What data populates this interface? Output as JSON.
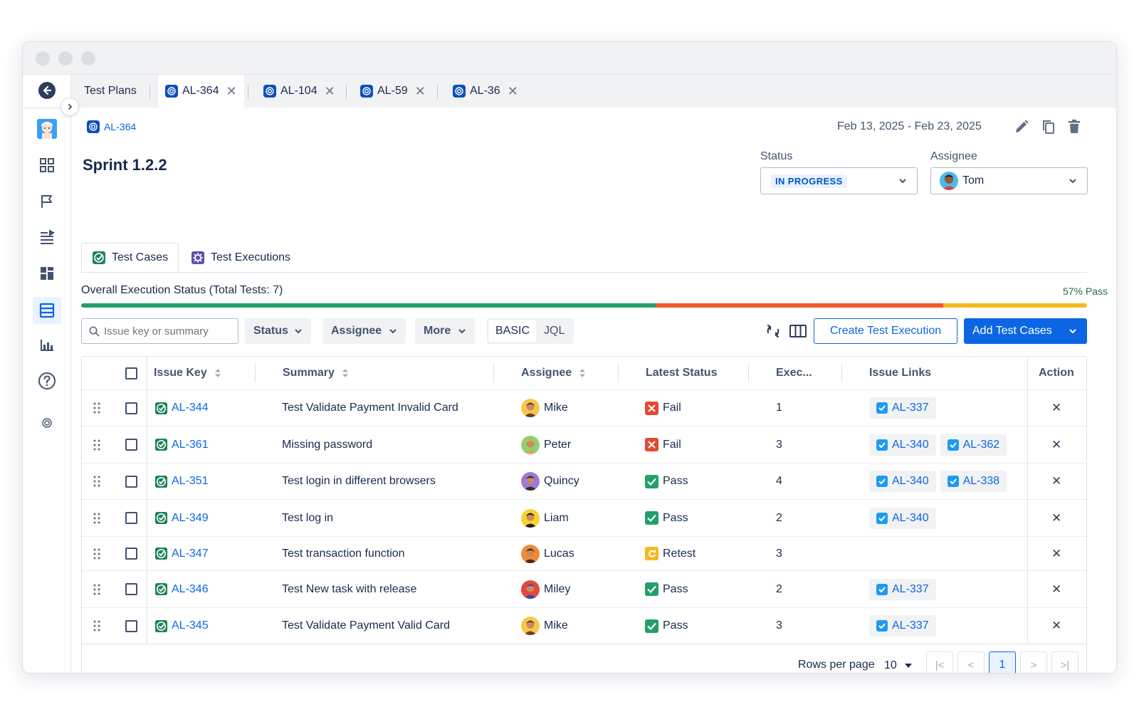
{
  "tabs": [
    {
      "label": "Test Plans"
    },
    {
      "label": "AL-364"
    },
    {
      "label": "AL-104"
    },
    {
      "label": "AL-59"
    },
    {
      "label": "AL-36"
    }
  ],
  "breadcrumb": {
    "label": "AL-364"
  },
  "header": {
    "title": "Sprint 1.2.2",
    "date_range": "Feb 13, 2025 - Feb 23, 2025",
    "status_label": "Status",
    "status_value": "IN PROGRESS",
    "assignee_label": "Assignee",
    "assignee_value": "Tom"
  },
  "content_tabs": [
    {
      "label": "Test Cases"
    },
    {
      "label": "Test Executions"
    }
  ],
  "execution": {
    "title": "Overall Execution Status (Total Tests: 7)",
    "pass_label": "57% Pass",
    "pass_fraction": 0.571,
    "fail_fraction": 0.286,
    "retest_fraction": 0.143,
    "colors": {
      "pass": "#22a06b",
      "fail": "#f15b2a",
      "retest": "#f5b921"
    }
  },
  "filters": {
    "search_placeholder": "Issue key or summary",
    "status": "Status",
    "assignee": "Assignee",
    "more": "More",
    "basic": "BASIC",
    "jql": "JQL",
    "create_execution": "Create Test Execution",
    "add_cases": "Add Test Cases"
  },
  "table": {
    "headers": {
      "key": "Issue Key",
      "summary": "Summary",
      "assignee": "Assignee",
      "status": "Latest Status",
      "exec": "Exec...",
      "links": "Issue Links",
      "action": "Action"
    },
    "rows": [
      {
        "key": "AL-344",
        "summary": "Test Validate Payment Invalid Card",
        "assignee": "Mike",
        "status": "Fail",
        "exec": "1",
        "links": [
          "AL-337"
        ]
      },
      {
        "key": "AL-361",
        "summary": "Missing password",
        "assignee": "Peter",
        "status": "Fail",
        "exec": "3",
        "links": [
          "AL-340",
          "AL-362"
        ]
      },
      {
        "key": "AL-351",
        "summary": "Test login in different browsers",
        "assignee": "Quincy",
        "status": "Pass",
        "exec": "4",
        "links": [
          "AL-340",
          "AL-338"
        ]
      },
      {
        "key": "AL-349",
        "summary": "Test log in",
        "assignee": "Liam",
        "status": "Pass",
        "exec": "2",
        "links": [
          "AL-340"
        ]
      },
      {
        "key": "AL-347",
        "summary": "Test transaction function",
        "assignee": "Lucas",
        "status": "Retest",
        "exec": "3",
        "links": []
      },
      {
        "key": "AL-346",
        "summary": "Test New task with release",
        "assignee": "Miley",
        "status": "Pass",
        "exec": "2",
        "links": [
          "AL-337"
        ]
      },
      {
        "key": "AL-345",
        "summary": "Test Validate Payment Valid Card",
        "assignee": "Mike",
        "status": "Pass",
        "exec": "3",
        "links": [
          "AL-337"
        ]
      }
    ]
  },
  "pagination": {
    "rows_per_page_label": "Rows per page",
    "rows_per_page": "10",
    "current_page": "1"
  }
}
